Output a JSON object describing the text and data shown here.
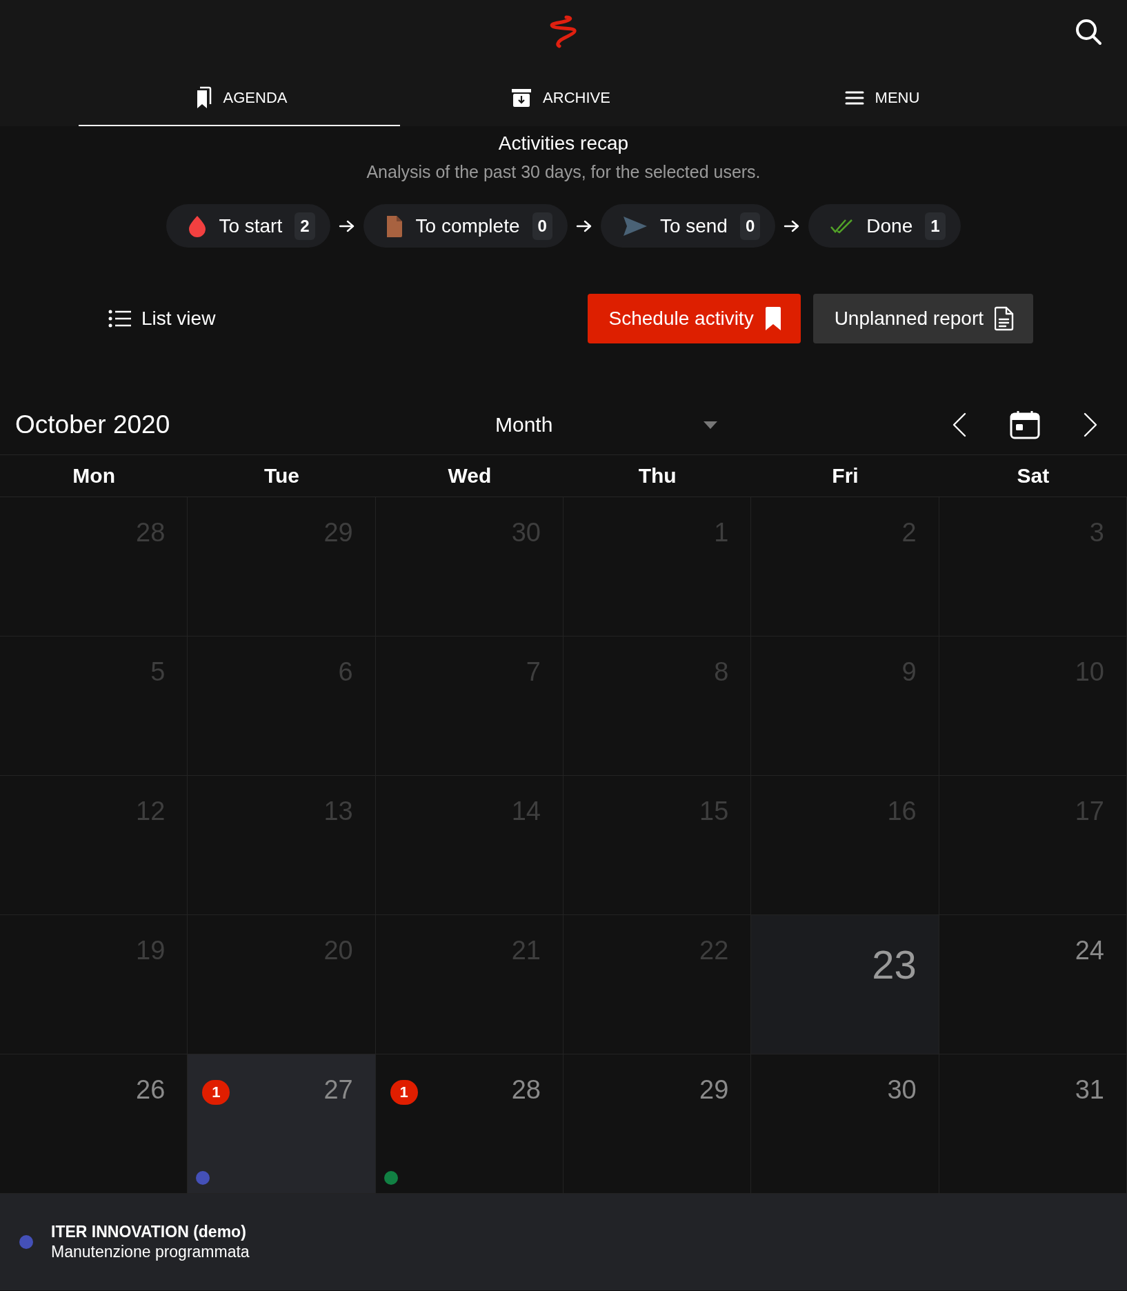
{
  "header": {
    "tabs": [
      {
        "label": "AGENDA",
        "selected": true
      },
      {
        "label": "ARCHIVE",
        "selected": false
      },
      {
        "label": "MENU",
        "selected": false
      }
    ]
  },
  "recap": {
    "title": "Activities recap",
    "subtitle": "Analysis of the past 30 days, for the selected users.",
    "stages": [
      {
        "label": "To start",
        "count": "2"
      },
      {
        "label": "To complete",
        "count": "0"
      },
      {
        "label": "To send",
        "count": "0"
      },
      {
        "label": "Done",
        "count": "1"
      }
    ]
  },
  "actions": {
    "list_view": "List view",
    "schedule": "Schedule activity",
    "unplanned": "Unplanned report"
  },
  "calendar": {
    "title": "October 2020",
    "view_select": "Month",
    "weekdays": [
      "Mon",
      "Tue",
      "Wed",
      "Thu",
      "Fri",
      "Sat"
    ],
    "weeks": [
      [
        {
          "day": "28",
          "past": true,
          "today": false,
          "selected": false
        },
        {
          "day": "29",
          "past": true,
          "today": false,
          "selected": false
        },
        {
          "day": "30",
          "past": true,
          "today": false,
          "selected": false
        },
        {
          "day": "1",
          "past": true,
          "today": false,
          "selected": false
        },
        {
          "day": "2",
          "past": true,
          "today": false,
          "selected": false
        },
        {
          "day": "3",
          "past": true,
          "today": false,
          "selected": false
        }
      ],
      [
        {
          "day": "5",
          "past": true,
          "today": false,
          "selected": false
        },
        {
          "day": "6",
          "past": true,
          "today": false,
          "selected": false
        },
        {
          "day": "7",
          "past": true,
          "today": false,
          "selected": false
        },
        {
          "day": "8",
          "past": true,
          "today": false,
          "selected": false
        },
        {
          "day": "9",
          "past": true,
          "today": false,
          "selected": false
        },
        {
          "day": "10",
          "past": true,
          "today": false,
          "selected": false
        }
      ],
      [
        {
          "day": "12",
          "past": true,
          "today": false,
          "selected": false
        },
        {
          "day": "13",
          "past": true,
          "today": false,
          "selected": false
        },
        {
          "day": "14",
          "past": true,
          "today": false,
          "selected": false
        },
        {
          "day": "15",
          "past": true,
          "today": false,
          "selected": false
        },
        {
          "day": "16",
          "past": true,
          "today": false,
          "selected": false
        },
        {
          "day": "17",
          "past": true,
          "today": false,
          "selected": false
        }
      ],
      [
        {
          "day": "19",
          "past": true,
          "today": false,
          "selected": false
        },
        {
          "day": "20",
          "past": true,
          "today": false,
          "selected": false
        },
        {
          "day": "21",
          "past": true,
          "today": false,
          "selected": false
        },
        {
          "day": "22",
          "past": true,
          "today": false,
          "selected": false
        },
        {
          "day": "23",
          "past": false,
          "today": true,
          "selected": false
        },
        {
          "day": "24",
          "past": false,
          "today": false,
          "selected": false
        }
      ],
      [
        {
          "day": "26",
          "past": false,
          "today": false,
          "selected": false
        },
        {
          "day": "27",
          "past": false,
          "today": false,
          "selected": true,
          "badge": "1",
          "events": [
            {
              "color": "#4450b8"
            }
          ]
        },
        {
          "day": "28",
          "past": false,
          "today": false,
          "selected": false,
          "badge": "1",
          "events": [
            {
              "color": "#118043"
            }
          ]
        },
        {
          "day": "29",
          "past": false,
          "today": false,
          "selected": false
        },
        {
          "day": "30",
          "past": false,
          "today": false,
          "selected": false
        },
        {
          "day": "31",
          "past": false,
          "today": false,
          "selected": false
        }
      ]
    ]
  },
  "event_detail": {
    "color": "#4450b8",
    "title": "ITER INNOVATION (demo)",
    "subtitle": "Manutenzione programmata"
  }
}
